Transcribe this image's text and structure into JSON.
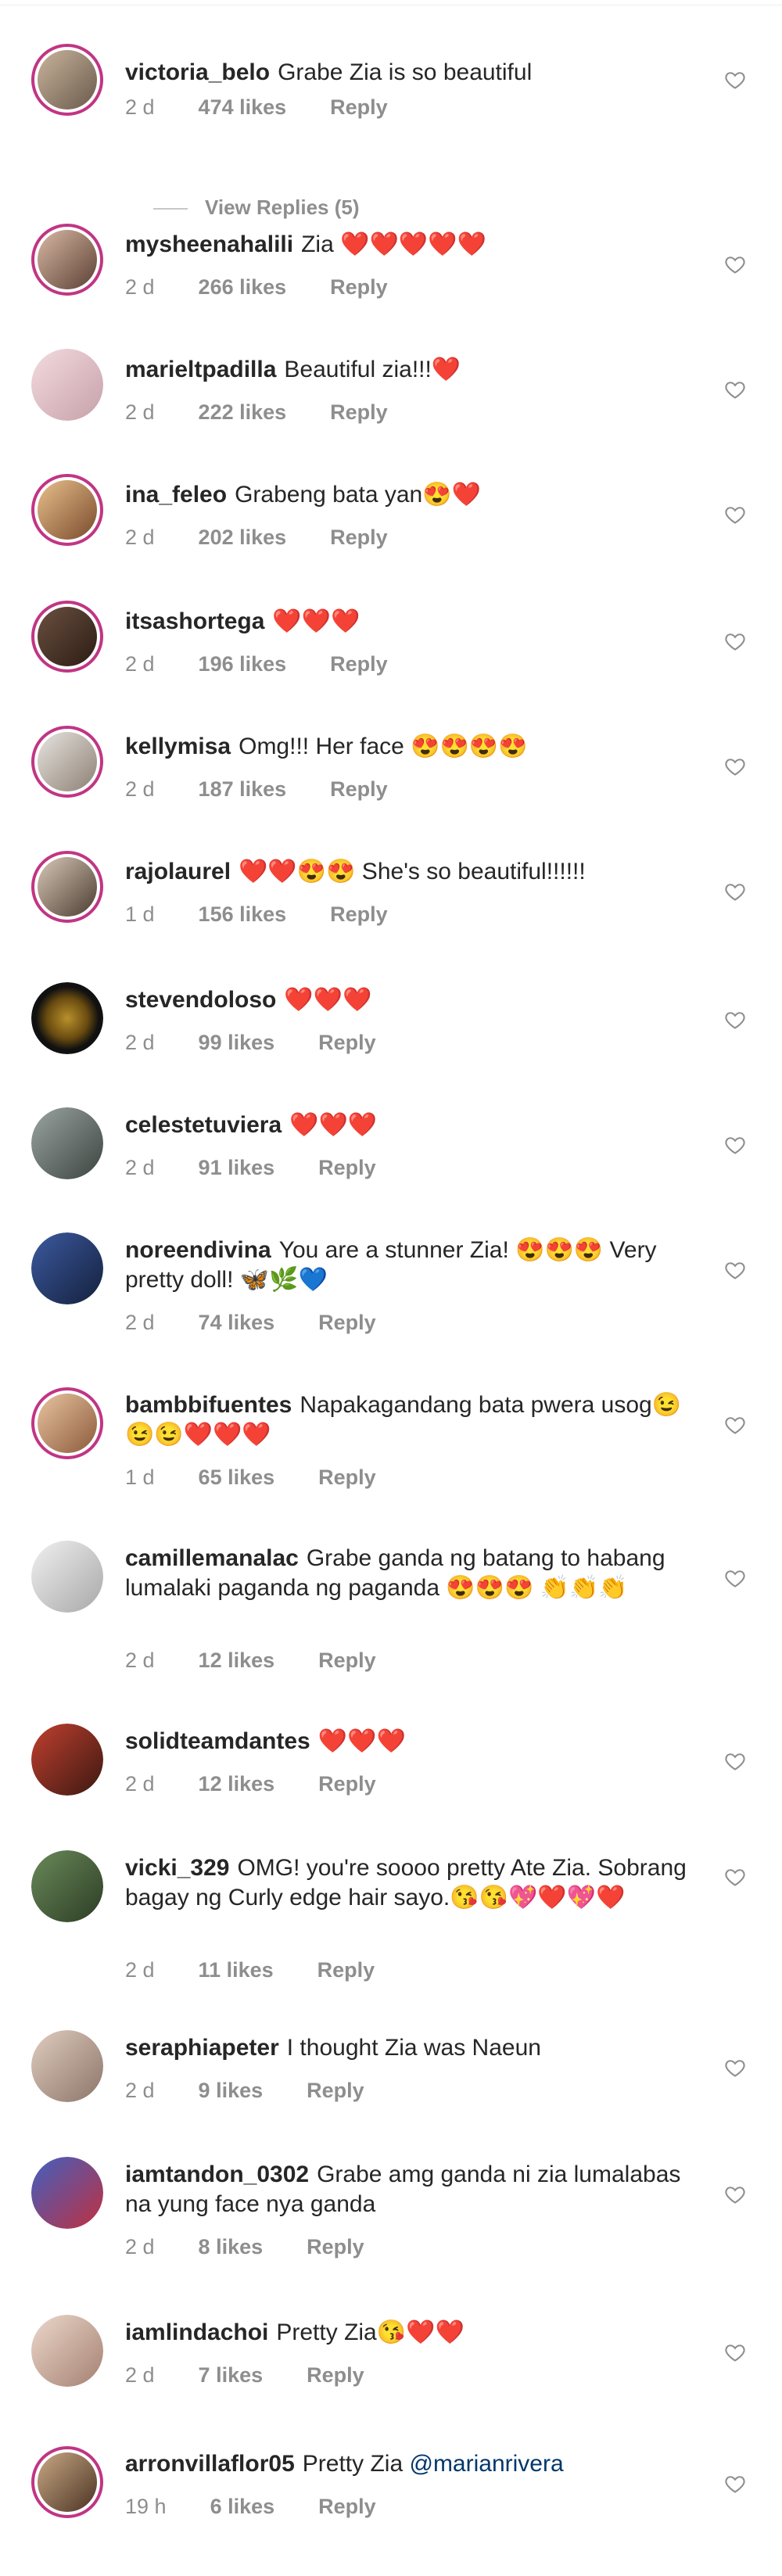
{
  "colors": {
    "story_ring": "#c13584",
    "text": "#262626",
    "meta": "#8e8e8e",
    "mention": "#00376b",
    "heart_emoji": "#e0245e"
  },
  "view_replies_label": "View Replies (5)",
  "reply_label": "Reply",
  "comments": [
    {
      "username": "victoria_belo",
      "text": "Grabe Zia is so beautiful",
      "emoji": "",
      "time": "2 d",
      "likes": "474 likes",
      "story": true
    },
    {
      "username": "mysheenahalili",
      "text": "Zia",
      "emoji": "❤️❤️❤️❤️❤️",
      "time": "2 d",
      "likes": "266 likes",
      "story": true
    },
    {
      "username": "marieltpadilla",
      "text": "Beautiful zia!!!",
      "emoji": "❤️",
      "time": "2 d",
      "likes": "222 likes",
      "story": false
    },
    {
      "username": "ina_feleo",
      "text": "Grabeng bata yan",
      "emoji": "😍❤️",
      "time": "2 d",
      "likes": "202 likes",
      "story": true
    },
    {
      "username": "itsashortega",
      "text": "",
      "emoji": "❤️❤️❤️",
      "time": "2 d",
      "likes": "196 likes",
      "story": true
    },
    {
      "username": "kellymisa",
      "text": "Omg!!! Her face",
      "emoji": "😍😍😍😍",
      "time": "2 d",
      "likes": "187 likes",
      "story": true
    },
    {
      "username": "rajolaurel",
      "text": "❤️❤️😍😍 She's so beautiful!!!!!!",
      "emoji": "",
      "time": "1 d",
      "likes": "156 likes",
      "story": true
    },
    {
      "username": "stevendoloso",
      "text": "",
      "emoji": "❤️❤️❤️",
      "time": "2 d",
      "likes": "99 likes",
      "story": false
    },
    {
      "username": "celestetuviera",
      "text": "",
      "emoji": "❤️❤️❤️",
      "time": "2 d",
      "likes": "91 likes",
      "story": false
    },
    {
      "username": "noreendivina",
      "text": "You are a stunner Zia! 😍😍😍 Very pretty doll! 🦋🌿💙",
      "emoji": "",
      "time": "2 d",
      "likes": "74 likes",
      "story": false
    },
    {
      "username": "bambbifuentes",
      "text": "Napakagandang bata pwera usog😉😉😉❤️❤️❤️",
      "emoji": "",
      "time": "1 d",
      "likes": "65 likes",
      "story": true
    },
    {
      "username": "camillemanalac",
      "text": "Grabe ganda ng batang to habang lumalaki paganda ng paganda 😍😍😍 👏👏👏",
      "emoji": "",
      "time": "2 d",
      "likes": "12 likes",
      "story": false
    },
    {
      "username": "solidteamdantes",
      "text": "",
      "emoji": "❤️❤️❤️",
      "time": "2 d",
      "likes": "12 likes",
      "story": false
    },
    {
      "username": "vicki_329",
      "text": "OMG! you're soooo pretty Ate Zia. Sobrang bagay ng Curly edge hair sayo.😘😘💖❤️💖❤️",
      "emoji": "",
      "time": "2 d",
      "likes": "11 likes",
      "story": false
    },
    {
      "username": "seraphiapeter",
      "text": "I thought Zia was Naeun",
      "emoji": "",
      "time": "2 d",
      "likes": "9 likes",
      "story": false
    },
    {
      "username": "iamtandon_0302",
      "text": "Grabe amg ganda ni zia lumalabas na yung face nya ganda",
      "emoji": "",
      "time": "2 d",
      "likes": "8 likes",
      "story": false
    },
    {
      "username": "iamlindachoi",
      "text": "Pretty Zia",
      "emoji": "😘❤️❤️",
      "time": "2 d",
      "likes": "7 likes",
      "story": false
    },
    {
      "username": "arronvillaflor05",
      "text": "Pretty Zia",
      "mention": "@marianrivera",
      "emoji": "",
      "time": "19 h",
      "likes": "6 likes",
      "story": true
    }
  ]
}
